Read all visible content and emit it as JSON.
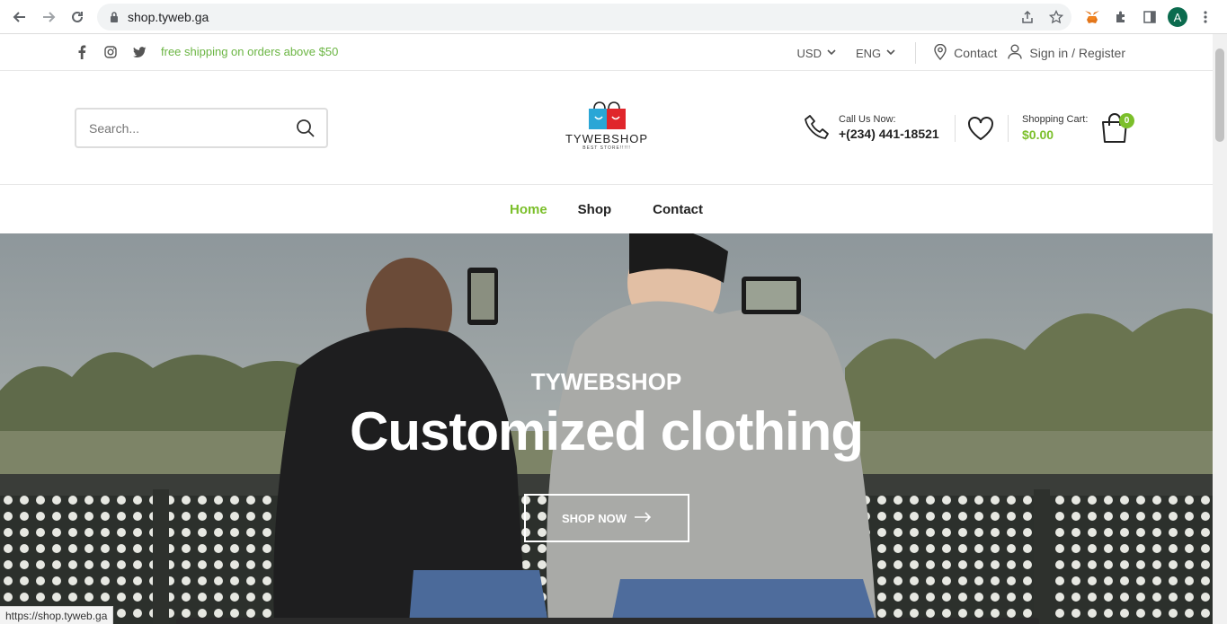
{
  "browser": {
    "url": "shop.tyweb.ga",
    "profile_initial": "A",
    "status_url": "https://shop.tyweb.ga"
  },
  "topbar": {
    "promo": "free shipping on orders above $50",
    "currency": "USD",
    "language": "ENG",
    "contact": "Contact",
    "signin": "Sign in / Register",
    "social_icons": [
      "facebook-icon",
      "instagram-icon",
      "twitter-icon"
    ]
  },
  "header": {
    "search_placeholder": "Search...",
    "logo_text": "TYWEBSHOP",
    "logo_tagline": "BEST STORE!!!!!",
    "call_label": "Call Us Now:",
    "call_number": "+(234) 441-18521",
    "cart_label": "Shopping Cart:",
    "cart_amount": "$0.00",
    "cart_count": "0"
  },
  "nav": {
    "items": [
      {
        "label": "Home",
        "active": true
      },
      {
        "label": "Shop",
        "active": false
      },
      {
        "label": "Contact",
        "active": false
      }
    ]
  },
  "hero": {
    "brand": "TYWEBSHOP",
    "headline": "Customized clothing",
    "cta": "SHOP NOW"
  },
  "colors": {
    "accent_green": "#7bbf2a",
    "promo_green": "#6bb543"
  }
}
